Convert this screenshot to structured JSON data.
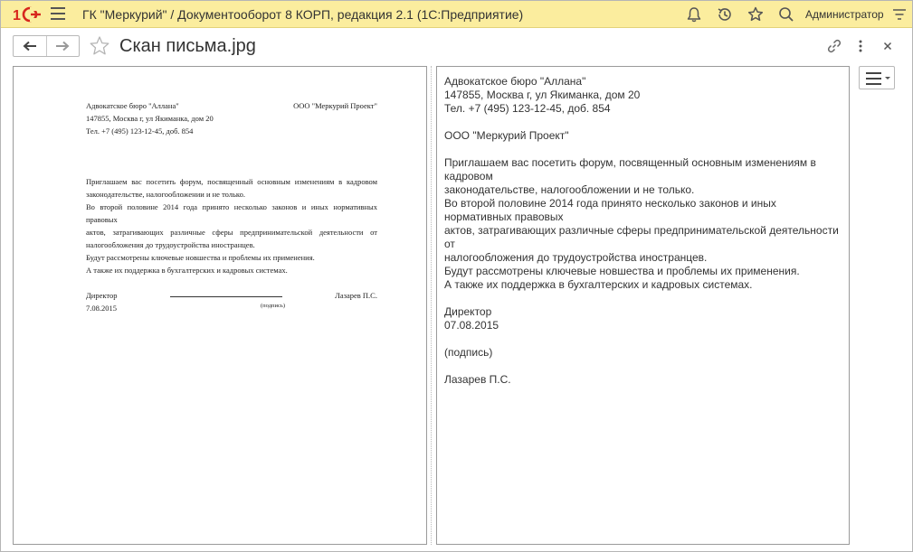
{
  "titlebar": {
    "logo": "1С",
    "app_title": "ГК \"Меркурий\" / Документооборот 8 КОРП, редакция 2.1  (1С:Предприятие)",
    "user": "Администратор",
    "icons": [
      "bell-icon",
      "history-icon",
      "star-icon",
      "search-icon",
      "settings-lines-icon"
    ],
    "colors": {
      "background": "#fbed9e",
      "logo_red": "#d7261d"
    }
  },
  "form": {
    "title": "Скан письма.jpg",
    "icons": [
      "back-arrow-icon",
      "forward-arrow-icon",
      "favorite-star-icon",
      "link-icon",
      "more-vertical-icon",
      "close-icon"
    ]
  },
  "scan": {
    "sender": "Адвокатское бюро \"Аллана\"",
    "recipient": "ООО \"Меркурий Проект\"",
    "address": "147855, Москва г, ул Якиманка, дом 20",
    "phone": "Тел. +7 (495) 123-12-45, доб. 854",
    "body_1a": "Приглашаем вас посетить форум, посвященный основным изменениям в кадровом",
    "body_1b": "законодательстве, налогообложении и не только.",
    "body_2a": "Во второй половине 2014 года принято несколько законов и иных нормативных правовых",
    "body_2b": "актов, затрагивающих различные сферы предпринимательской деятельности от",
    "body_2c": "налогообложения до трудоустройства иностранцев.",
    "body_3": "Будут рассмотрены ключевые новшества и проблемы их применения.",
    "body_4": "А также их поддержка в бухгалтерских и кадровых системах.",
    "position": "Директор",
    "signer": "Лазарев П.С.",
    "date": "7.08.2015",
    "signature_caption": "(подпись)"
  },
  "recognized_text": {
    "lines": [
      "Адвокатское бюро \"Аллана\"",
      "147855, Москва г, ул Якиманка, дом 20",
      "Тел. +7 (495) 123-12-45, доб. 854",
      "",
      "ООО \"Меркурий Проект\"",
      "",
      "Приглашаем вас посетить форум, посвященный основным изменениям в",
      "кадровом",
      "законодательстве, налогообложении и не только.",
      "Во второй половине 2014 года принято несколько законов и иных",
      "нормативных правовых",
      "актов, затрагивающих различные сферы предпринимательской деятельности",
      "от",
      "налогообложения до трудоустройства иностранцев.",
      "Будут рассмотрены ключевые новшества и проблемы их применения.",
      "А также их поддержка в бухгалтерских и кадровых системах.",
      "",
      "Директор",
      "07.08.2015",
      "",
      "(подпись)",
      "",
      "Лазарев П.С."
    ]
  },
  "menu_button": {
    "icon": "hamburger-menu-icon"
  }
}
